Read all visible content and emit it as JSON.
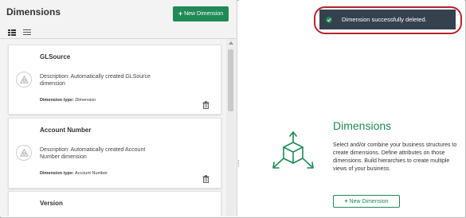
{
  "left_panel": {
    "title": "Dimensions",
    "new_button_label": "New Dimension",
    "new_button_plus": "+"
  },
  "cards": [
    {
      "name": "GLSource",
      "description": "Description: Automatically created GLSource dimension",
      "type_label": "Dimension type:",
      "type_value": "Dimension"
    },
    {
      "name": "Account Number",
      "description": "Description: Automatically created Account Number dimension",
      "type_label": "Dimension type:",
      "type_value": "Account Number"
    },
    {
      "name": "Version"
    }
  ],
  "toast": {
    "message": "Dimension successfully deleted."
  },
  "empty_state": {
    "title": "Dimensions",
    "description": "Select and/or combine your business structures to create dimensions. Define attributes on those dimensions. Build hierarchies to create multiple views of your business.",
    "button_label": "New Dimension",
    "button_plus": "+"
  },
  "colors": {
    "accent": "#1f8a55",
    "toast_bg": "#36414e",
    "highlight": "#b8222e"
  }
}
